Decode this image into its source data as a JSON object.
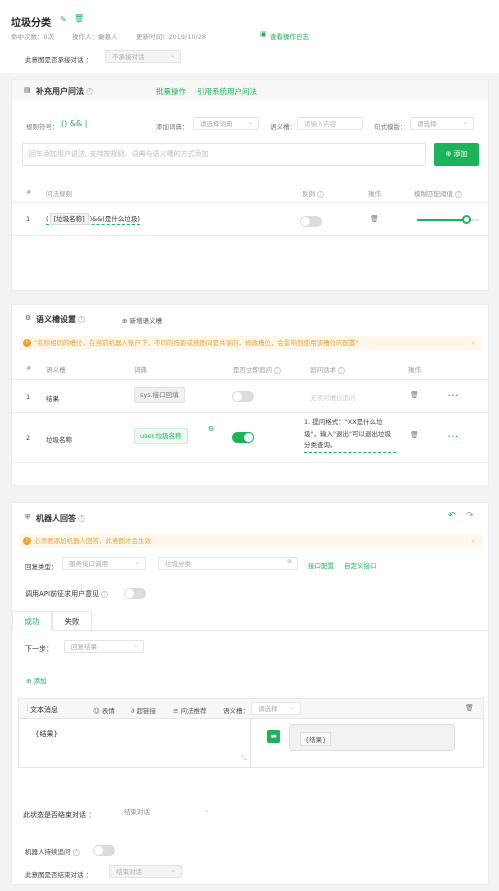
{
  "header": {
    "title": "垃圾分类",
    "stats_hits": "命中次数：0次",
    "stats_operator": "操作人：癫慕人",
    "stats_updated": "更新时间：2019/10/28",
    "log_link": "查看操作日志",
    "continue_label": "此意图是否承接对话",
    "continue_value": "不承接对话"
  },
  "utterance": {
    "title": "补充用户问法",
    "batch": "批量操作",
    "reference": "引用系统用户问法",
    "rule_symbol_label": "规则符号：",
    "rule_symbol_value": "() && |",
    "dict_label": "添加词典：",
    "dict_placeholder": "请选择词典",
    "slot_label": "语义槽：",
    "slot_placeholder": "请输入内容",
    "template_label": "句式模版：",
    "template_placeholder": "请选择",
    "add_placeholder": "回车添加用户说法, 支持按规则、词典与语义槽的方式添加",
    "add_button": "添加",
    "columns": [
      "#",
      "问法规则",
      "反例",
      "操作",
      "模糊匹配阈值"
    ],
    "rows": [
      {
        "index": "1",
        "rule_prefix": "(",
        "rule_tag": "[垃圾名称]",
        "rule_suffix": ")&&(是什么垃圾)"
      }
    ]
  },
  "slots": {
    "title": "语义槽设置",
    "add": "新增语义槽",
    "warning": "\"名称相同的槽位，在当前机器人账户下，不同的技能或意图间是共享的，修改槽位，会影响到使用该槽位的配置\"",
    "columns": [
      "#",
      "语义槽",
      "词典",
      "是否立即追问",
      "追问话术",
      "操作"
    ],
    "rows": [
      {
        "index": "1",
        "name": "结果",
        "dict": "sys.接口回填",
        "prompt": "无须对槽位追问",
        "more": "..."
      },
      {
        "index": "2",
        "name": "垃圾名称",
        "dict": "user.垃圾名称",
        "prompt": "1. 提问格式：\"XX是什么垃圾\"，输入\"退出\"可以退出垃圾分类查询。",
        "more": "..."
      }
    ]
  },
  "reply": {
    "title": "机器人回答",
    "warning": "必须要添加机器人回答，此意图才会生效",
    "type_label": "回复类型：",
    "type_value": "服务接口调用",
    "service_value": "垃圾分类",
    "interface_config": "接口配置",
    "custom_interface": "自定义接口",
    "api_label": "调用API前征求用户意见",
    "tab_success": "成功",
    "tab_fail": "失败",
    "next_label": "下一步：",
    "next_value": "回复结果",
    "add": "添加",
    "msg_type": "文本消息",
    "emoji": "表情",
    "link": "超链接",
    "recommend": "问法推荐",
    "slot_label": "语义槽：",
    "slot_placeholder": "请选择",
    "text_value": "{结果}",
    "preview_value": "{结果}",
    "end_label": "此状态是否结束对话",
    "end_value": "结束对话"
  },
  "footer": {
    "followup_label": "机器人持续追问",
    "end_intent_label": "此意图是否结束对话",
    "end_intent_value": "结束对话"
  },
  "colors": {
    "accent": "#1bb45a",
    "warning": "#f0a22e"
  }
}
